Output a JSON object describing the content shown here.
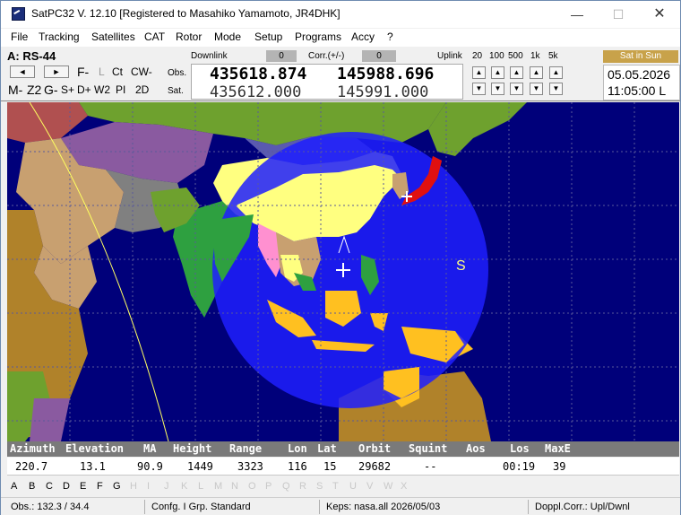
{
  "window": {
    "title": "SatPC32 V. 12.10  [Registered to Masahiko Yamamoto, JR4DHK]",
    "min_glyph": "—",
    "max_glyph": "☐",
    "close_glyph": "✕"
  },
  "menu": [
    "File",
    "Tracking",
    "Satellites",
    "CAT",
    "Rotor",
    "Mode",
    "Setup",
    "Programs",
    "Accy",
    "?"
  ],
  "panel": {
    "sat_name": "A: RS-44",
    "nav_left": "◄",
    "nav_right": "►",
    "row1": [
      "F-",
      "L",
      "Ct",
      "CW-"
    ],
    "row2": [
      "M-",
      "Z2",
      "G-",
      "S+",
      "D+",
      "W2",
      "PI",
      "2D"
    ],
    "downlink_label": "Downlink",
    "downlink_corr": "0",
    "corr_label": "Corr.(+/-)",
    "uplink_corr": "0",
    "uplink_label": "Uplink",
    "steps": [
      "20",
      "100",
      "500",
      "1k",
      "5k"
    ],
    "obs_label": "Obs.",
    "sat_label": "Sat.",
    "obs_down": "435618.874",
    "obs_up": "145988.696",
    "sat_down": "435612.000",
    "sat_up": "145991.000",
    "up_arrow": "▲",
    "down_arrow": "▼",
    "sun_badge": "Sat in Sun",
    "date": "05.05.2026",
    "time": "11:05:00 L"
  },
  "map": {
    "sat_marker": "S",
    "colors": {
      "ocean": "#00007a",
      "footprint": "#1e1eff",
      "yellow": "#ffff80"
    }
  },
  "data_headers": [
    "Azimuth",
    "Elevation",
    "MA",
    "Height",
    "Range",
    "Lon",
    "Lat",
    "Orbit",
    "Squint",
    "Aos",
    "Los",
    "MaxE"
  ],
  "data_values": [
    "220.7",
    "13.1",
    "90.9",
    "1449",
    "3323",
    "116",
    "15",
    "29682",
    "--",
    "",
    "00:19",
    "39"
  ],
  "letters_active": [
    "A",
    "B",
    "C",
    "D",
    "E",
    "F",
    "G"
  ],
  "letters_inactive": [
    "H",
    "I",
    "J",
    "K",
    "L",
    "M",
    "N",
    "O",
    "P",
    "Q",
    "R",
    "S",
    "T",
    "U",
    "V",
    "W",
    "X"
  ],
  "status": {
    "obs": "Obs.: 132.3 / 34.4",
    "config": "Confg. I  Grp. Standard",
    "keps": "Keps: nasa.all 2026/05/03",
    "doppl": "Doppl.Corr.: Upl/Dwnl"
  }
}
